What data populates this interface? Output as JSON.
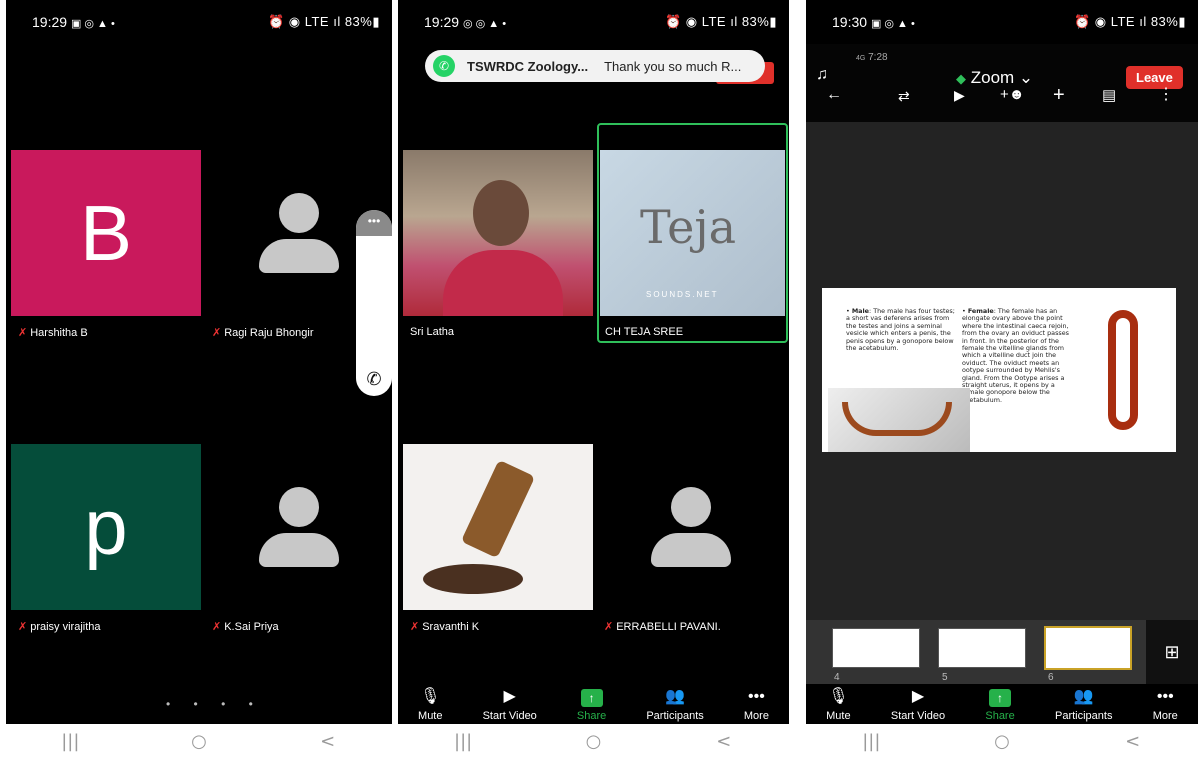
{
  "screens": [
    {
      "status": {
        "time": "19:29",
        "left_icons": "▣ ◎ ▲ •",
        "right": "⏰ ◉ LTE ıl 83%▮"
      },
      "participants": [
        {
          "name": "Harshitha B",
          "initial": "B",
          "color": "#c9195c"
        },
        {
          "name": "Ragi Raju Bhongir"
        },
        {
          "name": "praisy virajitha",
          "initial": "p",
          "color": "#054d3a"
        },
        {
          "name": "K.Sai Priya"
        }
      ],
      "page_dots": "• • • •",
      "call_menu": "•••",
      "call_icon": "✆"
    },
    {
      "status": {
        "time": "19:29",
        "left_icons": "◎ ◎ ▲ •",
        "right": "⏰ ◉ LTE ıl 83%▮"
      },
      "notification": {
        "app": "TSWRDC Zoology...",
        "message": "Thank you so much R..."
      },
      "participants": [
        {
          "name": "Sri Latha"
        },
        {
          "name": "CH TEJA SREE",
          "logo_text": "Teja",
          "logo_sub": "SOUNDS.NET"
        },
        {
          "name": "Sravanthi K"
        },
        {
          "name": "ERRABELLI PAVANI."
        }
      ],
      "toolbar": [
        "Mute",
        "Start Video",
        "Share",
        "Participants",
        "More"
      ]
    },
    {
      "status": {
        "time": "19:30",
        "left_icons": "▣ ◎ ▲ •",
        "right": "⏰ ◉ LTE ıl 83%▮"
      },
      "inner_status": {
        "time": "7:28",
        "signal": "4G"
      },
      "app_title": "Zoom",
      "leave_label": "Leave",
      "slide": {
        "male_title": "Male",
        "male_text": ": The male has four testes; a short vas deferens arises from the testes and joins a seminal vesicle which enters a penis, the penis opens by a gonopore below the acetabulum.",
        "female_title": "Female",
        "female_text": ": The female has an elongate ovary above the point where the intestinal caeca rejoin, from the ovary an oviduct passes in front. In the posterior of the female the vitelline glands from which a vitelline duct join the oviduct. The oviduct meets an ootype surrounded by Mehlis's gland. From the Ootype arises a straight uterus, it opens by a female gonopore below the acetabulum."
      },
      "thumbnails": [
        "4",
        "5",
        "6"
      ],
      "toolbar": [
        "Mute",
        "Start Video",
        "Share",
        "Participants",
        "More"
      ]
    }
  ],
  "nav": {
    "recent": "|||",
    "home": "○",
    "back": "<"
  }
}
